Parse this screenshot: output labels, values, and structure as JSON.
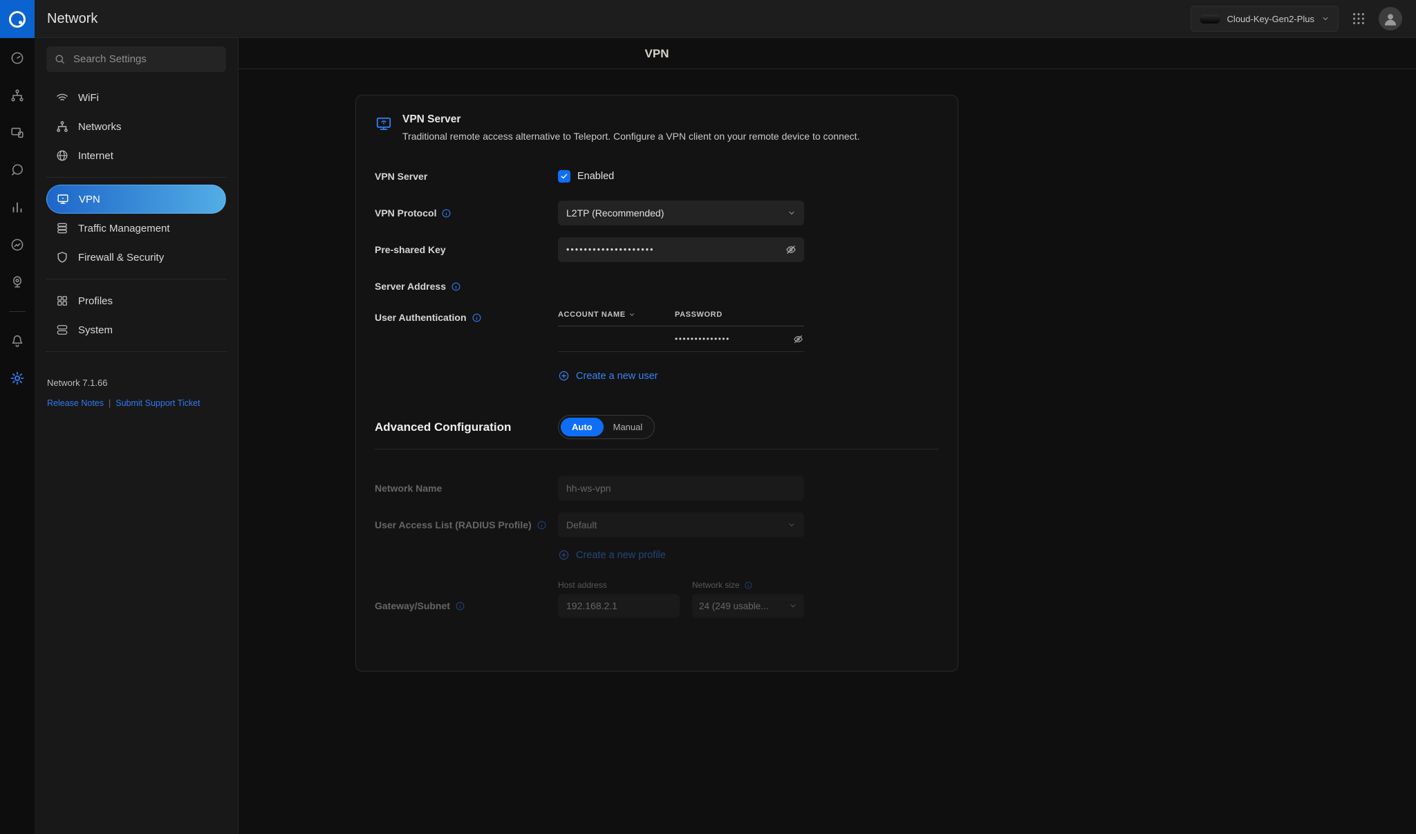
{
  "topbar": {
    "title": "Network",
    "device_name": "Cloud-Key-Gen2-Plus"
  },
  "sidebar": {
    "search_placeholder": "Search Settings",
    "items": [
      {
        "label": "WiFi"
      },
      {
        "label": "Networks"
      },
      {
        "label": "Internet"
      },
      {
        "label": "VPN",
        "selected": true
      },
      {
        "label": "Traffic Management"
      },
      {
        "label": "Firewall & Security"
      },
      {
        "label": "Profiles"
      },
      {
        "label": "System"
      }
    ],
    "version": "Network 7.1.66",
    "release_notes": "Release Notes",
    "link_separator": "|",
    "support_ticket": "Submit Support Ticket"
  },
  "page": {
    "title": "VPN"
  },
  "vpn_card": {
    "title": "VPN Server",
    "description": "Traditional remote access alternative to Teleport. Configure a VPN client on your remote device to connect.",
    "server_label": "VPN Server",
    "enabled_label": "Enabled",
    "protocol_label": "VPN Protocol",
    "protocol_value": "L2TP (Recommended)",
    "preshared_label": "Pre-shared Key",
    "preshared_value": "••••••••••••••••••••",
    "server_address_label": "Server Address",
    "user_auth_label": "User Authentication",
    "account_col": "ACCOUNT NAME",
    "password_col": "PASSWORD",
    "row_password": "••••••••••••••",
    "create_user": "Create a new user"
  },
  "advanced": {
    "title": "Advanced Configuration",
    "auto_label": "Auto",
    "manual_label": "Manual",
    "network_name_label": "Network Name",
    "network_name_value": "hh-ws-vpn",
    "radius_label": "User Access List (RADIUS Profile)",
    "radius_value": "Default",
    "create_profile": "Create a new profile",
    "gateway_label": "Gateway/Subnet",
    "host_label": "Host address",
    "host_value": "192.168.2.1",
    "size_label": "Network size",
    "size_value": "24 (249 usable..."
  },
  "colors": {
    "accent_blue": "#0e6ef5",
    "link_blue": "#3b82f6",
    "info_icon_blue": "#2f81f7",
    "selected_item_gradient_start": "#1d66c9",
    "selected_item_gradient_end": "#53aee4",
    "logo_blue": "#0b63cf"
  },
  "icons": {
    "topbar": [
      "unifi-logo",
      "chevron-down-icon",
      "apps-grid-icon",
      "user-avatar-icon"
    ],
    "rail": [
      "dashboard-icon",
      "topology-icon",
      "devices-icon",
      "clients-icon",
      "statistics-icon",
      "insights-icon",
      "system-log-icon",
      "notifications-bell-icon",
      "settings-gear-icon"
    ],
    "sidebar": [
      "search-icon",
      "wifi-icon",
      "networks-topology-icon",
      "internet-globe-icon",
      "vpn-monitor-icon",
      "traffic-management-icon",
      "firewall-shield-icon",
      "profiles-grid-icon",
      "system-stack-icon"
    ],
    "form": [
      "info-icon",
      "checkbox-check-icon",
      "chevron-down-icon",
      "eye-off-icon",
      "plus-circle-icon",
      "vpn-server-icon"
    ]
  }
}
